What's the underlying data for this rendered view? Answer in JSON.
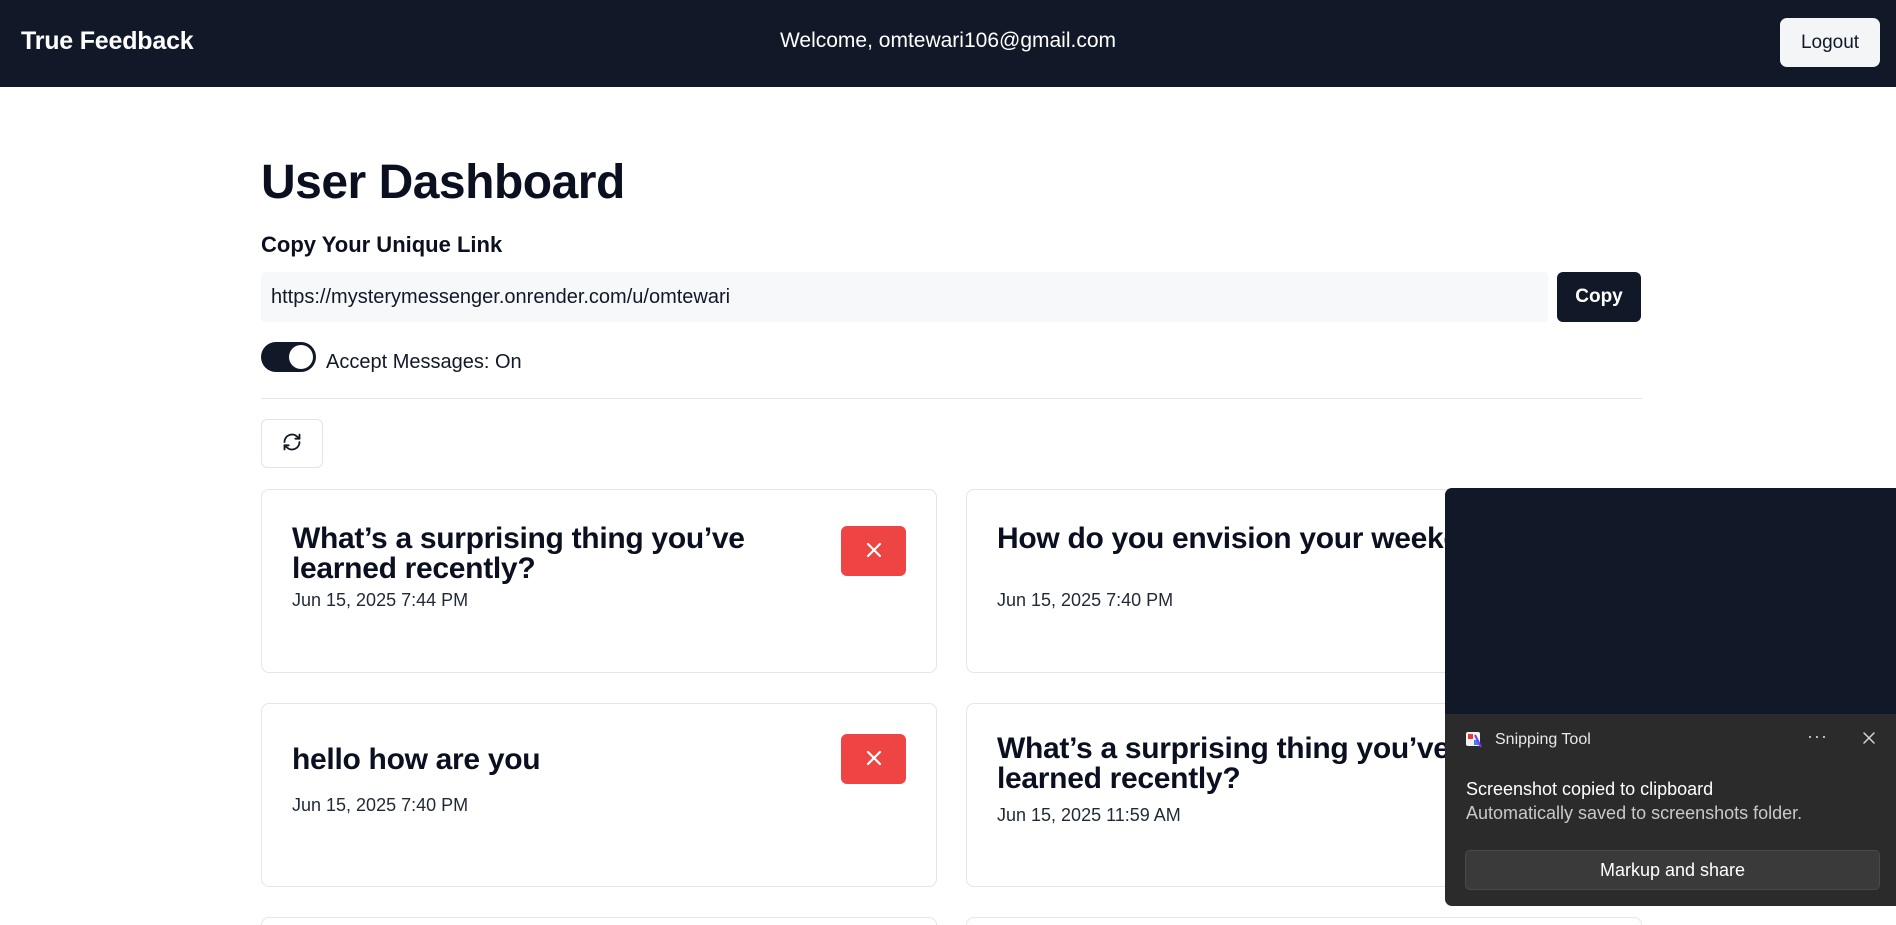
{
  "header": {
    "brand": "True Feedback",
    "welcome": "Welcome, omtewari106@gmail.com",
    "logout_label": "Logout"
  },
  "dashboard": {
    "title": "User Dashboard",
    "copy_link_heading": "Copy Your Unique Link",
    "unique_link": "https://mysterymessenger.onrender.com/u/omtewari",
    "copy_label": "Copy",
    "accept_messages_label": "Accept Messages: On",
    "accept_messages_on": true
  },
  "messages": [
    {
      "question": "What’s a surprising thing you’ve learned recently?",
      "date": "Jun 15, 2025 7:44 PM"
    },
    {
      "question": "How do you envision your weekend looking like?",
      "date": "Jun 15, 2025 7:40 PM"
    },
    {
      "question": "hello how are you",
      "date": "Jun 15, 2025 7:40 PM"
    },
    {
      "question": "What’s a surprising thing you’ve learned recently?",
      "date": "Jun 15, 2025 11:59 AM"
    }
  ],
  "toast": {
    "app_name": "Snipping Tool",
    "more_label": "···",
    "title": "Screenshot copied to clipboard",
    "subtitle": "Automatically saved to screenshots folder.",
    "action_label": "Markup and share"
  },
  "colors": {
    "navbar": "#111827",
    "delete": "#ef4444",
    "toast": "#2b2b2b"
  }
}
